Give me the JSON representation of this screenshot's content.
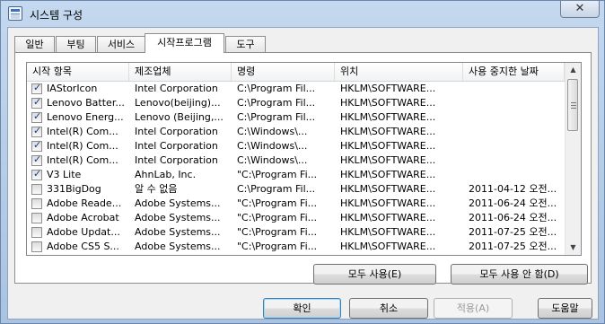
{
  "window": {
    "title": "시스템 구성",
    "close_symbol": "✕"
  },
  "tabs": [
    {
      "label": "일반"
    },
    {
      "label": "부팅"
    },
    {
      "label": "서비스"
    },
    {
      "label": "시작프로그램"
    },
    {
      "label": "도구"
    }
  ],
  "active_tab": "시작프로그램",
  "startup_list": {
    "columns": [
      "시작 항목",
      "제조업체",
      "명령",
      "위치",
      "사용 중지한 날짜"
    ],
    "rows": [
      {
        "checked": true,
        "item": "IAStorIcon",
        "manufacturer": "Intel Corporation",
        "command": "C:\\Program Fil...",
        "location": "HKLM\\SOFTWARE...",
        "date": ""
      },
      {
        "checked": true,
        "item": "Lenovo Batter...",
        "manufacturer": "Lenovo(beijing)...",
        "command": "C:\\Program Fil...",
        "location": "HKLM\\SOFTWARE...",
        "date": ""
      },
      {
        "checked": true,
        "item": "Lenovo Energ...",
        "manufacturer": "Lenovo (Beijing,...",
        "command": "C:\\Program Fil...",
        "location": "HKLM\\SOFTWARE...",
        "date": ""
      },
      {
        "checked": true,
        "item": "Intel(R) Com...",
        "manufacturer": "Intel Corporation",
        "command": "C:\\Windows\\...",
        "location": "HKLM\\SOFTWARE...",
        "date": ""
      },
      {
        "checked": true,
        "item": "Intel(R) Com...",
        "manufacturer": "Intel Corporation",
        "command": "C:\\Windows\\...",
        "location": "HKLM\\SOFTWARE...",
        "date": ""
      },
      {
        "checked": true,
        "item": "Intel(R) Com...",
        "manufacturer": "Intel Corporation",
        "command": "C:\\Windows\\...",
        "location": "HKLM\\SOFTWARE...",
        "date": ""
      },
      {
        "checked": true,
        "item": "V3 Lite",
        "manufacturer": "AhnLab, Inc.",
        "command": "\"C:\\Program Fi...",
        "location": "HKLM\\SOFTWARE...",
        "date": ""
      },
      {
        "checked": false,
        "item": "331BigDog",
        "manufacturer": "알 수 없음",
        "command": "C:\\Program Fil...",
        "location": "HKLM\\SOFTWARE...",
        "date": "2011-04-12 오전..."
      },
      {
        "checked": false,
        "item": "Adobe Reade...",
        "manufacturer": "Adobe Systems...",
        "command": "\"C:\\Program Fi...",
        "location": "HKLM\\SOFTWARE...",
        "date": "2011-06-24 오전..."
      },
      {
        "checked": false,
        "item": "Adobe Acrobat",
        "manufacturer": "Adobe Systems...",
        "command": "\"C:\\Program Fi...",
        "location": "HKLM\\SOFTWARE...",
        "date": "2011-06-24 오전..."
      },
      {
        "checked": false,
        "item": "Adobe Updat...",
        "manufacturer": "Adobe Systems...",
        "command": "\"C:\\Program Fi...",
        "location": "HKLM\\SOFTWARE...",
        "date": "2011-07-25 오전..."
      },
      {
        "checked": false,
        "item": "Adobe CS5 S...",
        "manufacturer": "Adobe Systems...",
        "command": "\"C:\\Program Fi...",
        "location": "HKLM\\SOFTWARE...",
        "date": "2011-07-25 오전..."
      }
    ]
  },
  "scrollbar": {
    "up_symbol": "▲",
    "down_symbol": "▼"
  },
  "list_buttons": {
    "enable_all": "모두 사용(E)",
    "disable_all": "모두 사용 안 함(D)"
  },
  "dialog_buttons": {
    "ok": "확인",
    "cancel": "취소",
    "apply": "적용(A)",
    "help": "도움말"
  }
}
